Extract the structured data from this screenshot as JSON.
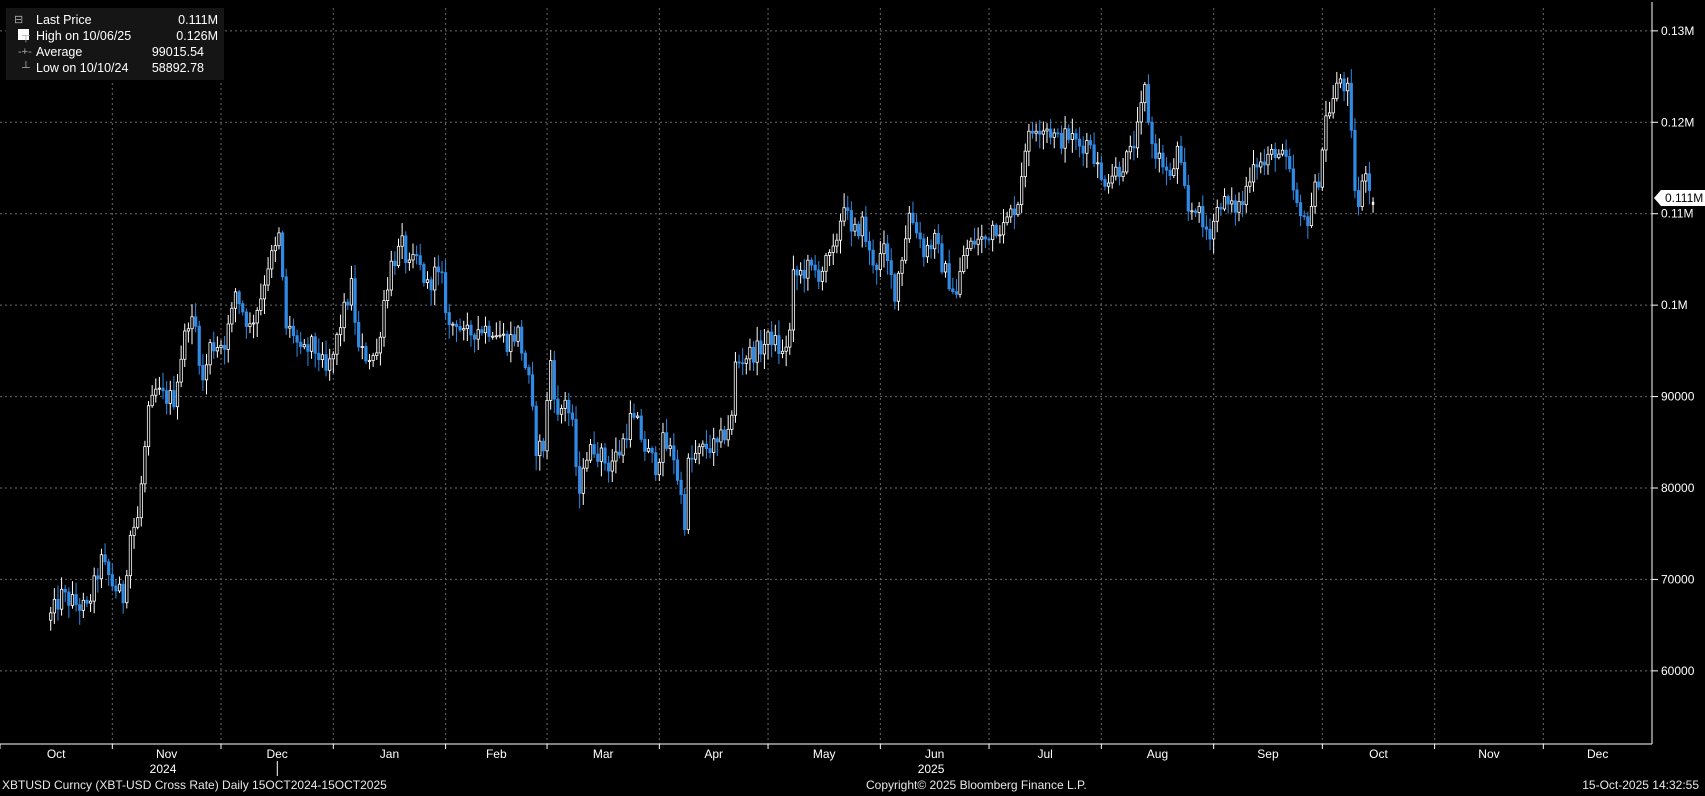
{
  "legend": {
    "last_label": "Last Price",
    "last_value": "0.111M",
    "high_label": "High on 10/06/25",
    "high_value": "0.126M",
    "avg_label": "Average",
    "avg_value": "99015.54",
    "low_label": "Low on 10/10/24",
    "low_value": "58892.78"
  },
  "footer": {
    "left": "XBTUSD Curncy (XBT-USD Cross Rate) Daily 15OCT2024-15OCT2025",
    "center": "Copyright© 2025 Bloomberg Finance L.P.",
    "right": "15-Oct-2025 14:32:55"
  },
  "last_badge": "0.111M",
  "chart_data": {
    "type": "candlestick",
    "title": "",
    "x_range": [
      "2024-10-01",
      "2025-12-31"
    ],
    "y_range": [
      52000,
      132500
    ],
    "grid": true,
    "y_ticks": [
      {
        "value": 60000,
        "label": "60000"
      },
      {
        "value": 70000,
        "label": "70000"
      },
      {
        "value": 80000,
        "label": "80000"
      },
      {
        "value": 90000,
        "label": "90000"
      },
      {
        "value": 100000,
        "label": "0.1M"
      },
      {
        "value": 110000,
        "label": "0.11M"
      },
      {
        "value": 120000,
        "label": "0.12M"
      },
      {
        "value": 130000,
        "label": "0.13M"
      }
    ],
    "x_ticks": [
      {
        "date": "2024-10-01",
        "label": "Oct"
      },
      {
        "date": "2024-11-01",
        "label": "Nov"
      },
      {
        "date": "2024-12-01",
        "label": "Dec"
      },
      {
        "date": "2025-01-01",
        "label": "Jan"
      },
      {
        "date": "2025-02-01",
        "label": "Feb"
      },
      {
        "date": "2025-03-01",
        "label": "Mar"
      },
      {
        "date": "2025-04-01",
        "label": "Apr"
      },
      {
        "date": "2025-05-01",
        "label": "May"
      },
      {
        "date": "2025-06-01",
        "label": "Jun"
      },
      {
        "date": "2025-07-01",
        "label": "Jul"
      },
      {
        "date": "2025-08-01",
        "label": "Aug"
      },
      {
        "date": "2025-09-01",
        "label": "Sep"
      },
      {
        "date": "2025-10-01",
        "label": "Oct"
      },
      {
        "date": "2025-11-01",
        "label": "Nov"
      },
      {
        "date": "2025-12-01",
        "label": "Dec"
      }
    ],
    "year_labels": [
      {
        "date": "2024-11-15",
        "label": "2024"
      },
      {
        "date": "2025-06-15",
        "label": "2025"
      }
    ],
    "colors": {
      "up": "#ffffff",
      "down": "#2f8be6",
      "grid": "#6a6a6a",
      "axis": "#ffffff",
      "text": "#ffffff"
    },
    "close_points": [
      [
        "2024-10-15",
        66000
      ],
      [
        "2024-10-18",
        68200
      ],
      [
        "2024-10-22",
        67300
      ],
      [
        "2024-10-25",
        66700
      ],
      [
        "2024-10-29",
        72000
      ],
      [
        "2024-11-01",
        69500
      ],
      [
        "2024-11-04",
        68000
      ],
      [
        "2024-11-06",
        75000
      ],
      [
        "2024-11-08",
        76500
      ],
      [
        "2024-11-11",
        88000
      ],
      [
        "2024-11-13",
        90500
      ],
      [
        "2024-11-15",
        90000
      ],
      [
        "2024-11-18",
        89800
      ],
      [
        "2024-11-20",
        94500
      ],
      [
        "2024-11-22",
        98500
      ],
      [
        "2024-11-24",
        97500
      ],
      [
        "2024-11-26",
        91500
      ],
      [
        "2024-11-28",
        95500
      ],
      [
        "2024-12-02",
        96000
      ],
      [
        "2024-12-04",
        99000
      ],
      [
        "2024-12-05",
        101500
      ],
      [
        "2024-12-07",
        99500
      ],
      [
        "2024-12-09",
        97500
      ],
      [
        "2024-12-12",
        101000
      ],
      [
        "2024-12-14",
        104500
      ],
      [
        "2024-12-16",
        106000
      ],
      [
        "2024-12-17",
        107500
      ],
      [
        "2024-12-19",
        97500
      ],
      [
        "2024-12-21",
        97000
      ],
      [
        "2024-12-23",
        94500
      ],
      [
        "2024-12-26",
        95500
      ],
      [
        "2024-12-28",
        94500
      ],
      [
        "2024-12-30",
        92500
      ],
      [
        "2025-01-01",
        94500
      ],
      [
        "2025-01-03",
        98000
      ],
      [
        "2025-01-06",
        102000
      ],
      [
        "2025-01-08",
        95000
      ],
      [
        "2025-01-10",
        94500
      ],
      [
        "2025-01-13",
        94500
      ],
      [
        "2025-01-15",
        100500
      ],
      [
        "2025-01-17",
        104500
      ],
      [
        "2025-01-20",
        106500
      ],
      [
        "2025-01-22",
        104000
      ],
      [
        "2025-01-24",
        105000
      ],
      [
        "2025-01-27",
        102000
      ],
      [
        "2025-01-29",
        103500
      ],
      [
        "2025-01-31",
        102500
      ],
      [
        "2025-02-02",
        97500
      ],
      [
        "2025-02-04",
        98500
      ],
      [
        "2025-02-06",
        96500
      ],
      [
        "2025-02-10",
        97500
      ],
      [
        "2025-02-14",
        97500
      ],
      [
        "2025-02-18",
        96000
      ],
      [
        "2025-02-21",
        97000
      ],
      [
        "2025-02-24",
        91500
      ],
      [
        "2025-02-26",
        84500
      ],
      [
        "2025-02-28",
        84500
      ],
      [
        "2025-03-02",
        94000
      ],
      [
        "2025-03-04",
        87500
      ],
      [
        "2025-03-06",
        90000
      ],
      [
        "2025-03-08",
        86500
      ],
      [
        "2025-03-10",
        78500
      ],
      [
        "2025-03-11",
        83000
      ],
      [
        "2025-03-14",
        84500
      ],
      [
        "2025-03-18",
        82500
      ],
      [
        "2025-03-21",
        84000
      ],
      [
        "2025-03-24",
        87500
      ],
      [
        "2025-03-26",
        86900
      ],
      [
        "2025-03-28",
        84300
      ],
      [
        "2025-03-31",
        82500
      ],
      [
        "2025-04-02",
        85000
      ],
      [
        "2025-04-05",
        83500
      ],
      [
        "2025-04-07",
        79000
      ],
      [
        "2025-04-08",
        76500
      ],
      [
        "2025-04-09",
        82500
      ],
      [
        "2025-04-11",
        83500
      ],
      [
        "2025-04-14",
        84500
      ],
      [
        "2025-04-17",
        84500
      ],
      [
        "2025-04-21",
        87500
      ],
      [
        "2025-04-22",
        93500
      ],
      [
        "2025-04-25",
        94500
      ],
      [
        "2025-04-28",
        95000
      ],
      [
        "2025-05-02",
        96500
      ],
      [
        "2025-05-05",
        94500
      ],
      [
        "2025-05-07",
        97000
      ],
      [
        "2025-05-08",
        103000
      ],
      [
        "2025-05-12",
        104000
      ],
      [
        "2025-05-15",
        103500
      ],
      [
        "2025-05-19",
        105500
      ],
      [
        "2025-05-21",
        109500
      ],
      [
        "2025-05-22",
        111500
      ],
      [
        "2025-05-24",
        107500
      ],
      [
        "2025-05-27",
        109000
      ],
      [
        "2025-05-29",
        105500
      ],
      [
        "2025-05-31",
        104500
      ],
      [
        "2025-06-02",
        105800
      ],
      [
        "2025-06-05",
        101500
      ],
      [
        "2025-06-07",
        105500
      ],
      [
        "2025-06-09",
        110000
      ],
      [
        "2025-06-11",
        108500
      ],
      [
        "2025-06-13",
        106000
      ],
      [
        "2025-06-16",
        107000
      ],
      [
        "2025-06-18",
        104500
      ],
      [
        "2025-06-22",
        101000
      ],
      [
        "2025-06-24",
        105500
      ],
      [
        "2025-06-27",
        107000
      ],
      [
        "2025-06-30",
        107200
      ],
      [
        "2025-07-02",
        108800
      ],
      [
        "2025-07-05",
        108500
      ],
      [
        "2025-07-09",
        111500
      ],
      [
        "2025-07-11",
        117500
      ],
      [
        "2025-07-14",
        119800
      ],
      [
        "2025-07-17",
        119500
      ],
      [
        "2025-07-20",
        118000
      ],
      [
        "2025-07-23",
        118500
      ],
      [
        "2025-07-26",
        117500
      ],
      [
        "2025-07-29",
        118000
      ],
      [
        "2025-08-01",
        113500
      ],
      [
        "2025-08-03",
        114200
      ],
      [
        "2025-08-06",
        115000
      ],
      [
        "2025-08-09",
        116500
      ],
      [
        "2025-08-11",
        119000
      ],
      [
        "2025-08-13",
        123500
      ],
      [
        "2025-08-15",
        117500
      ],
      [
        "2025-08-18",
        115500
      ],
      [
        "2025-08-20",
        113500
      ],
      [
        "2025-08-22",
        116800
      ],
      [
        "2025-08-25",
        110200
      ],
      [
        "2025-08-27",
        111000
      ],
      [
        "2025-08-29",
        108500
      ],
      [
        "2025-08-31",
        108200
      ],
      [
        "2025-09-03",
        111500
      ],
      [
        "2025-09-06",
        110500
      ],
      [
        "2025-09-09",
        111200
      ],
      [
        "2025-09-12",
        116000
      ],
      [
        "2025-09-15",
        115300
      ],
      [
        "2025-09-18",
        117000
      ],
      [
        "2025-09-21",
        115500
      ],
      [
        "2025-09-23",
        112500
      ],
      [
        "2025-09-25",
        109000
      ],
      [
        "2025-09-27",
        109600
      ],
      [
        "2025-09-30",
        114000
      ],
      [
        "2025-10-02",
        120500
      ],
      [
        "2025-10-04",
        122500
      ],
      [
        "2025-10-06",
        124800
      ],
      [
        "2025-10-08",
        123300
      ],
      [
        "2025-10-10",
        113000
      ],
      [
        "2025-10-11",
        110700
      ],
      [
        "2025-10-13",
        115200
      ],
      [
        "2025-10-14",
        113000
      ],
      [
        "2025-10-15",
        111000
      ]
    ]
  }
}
